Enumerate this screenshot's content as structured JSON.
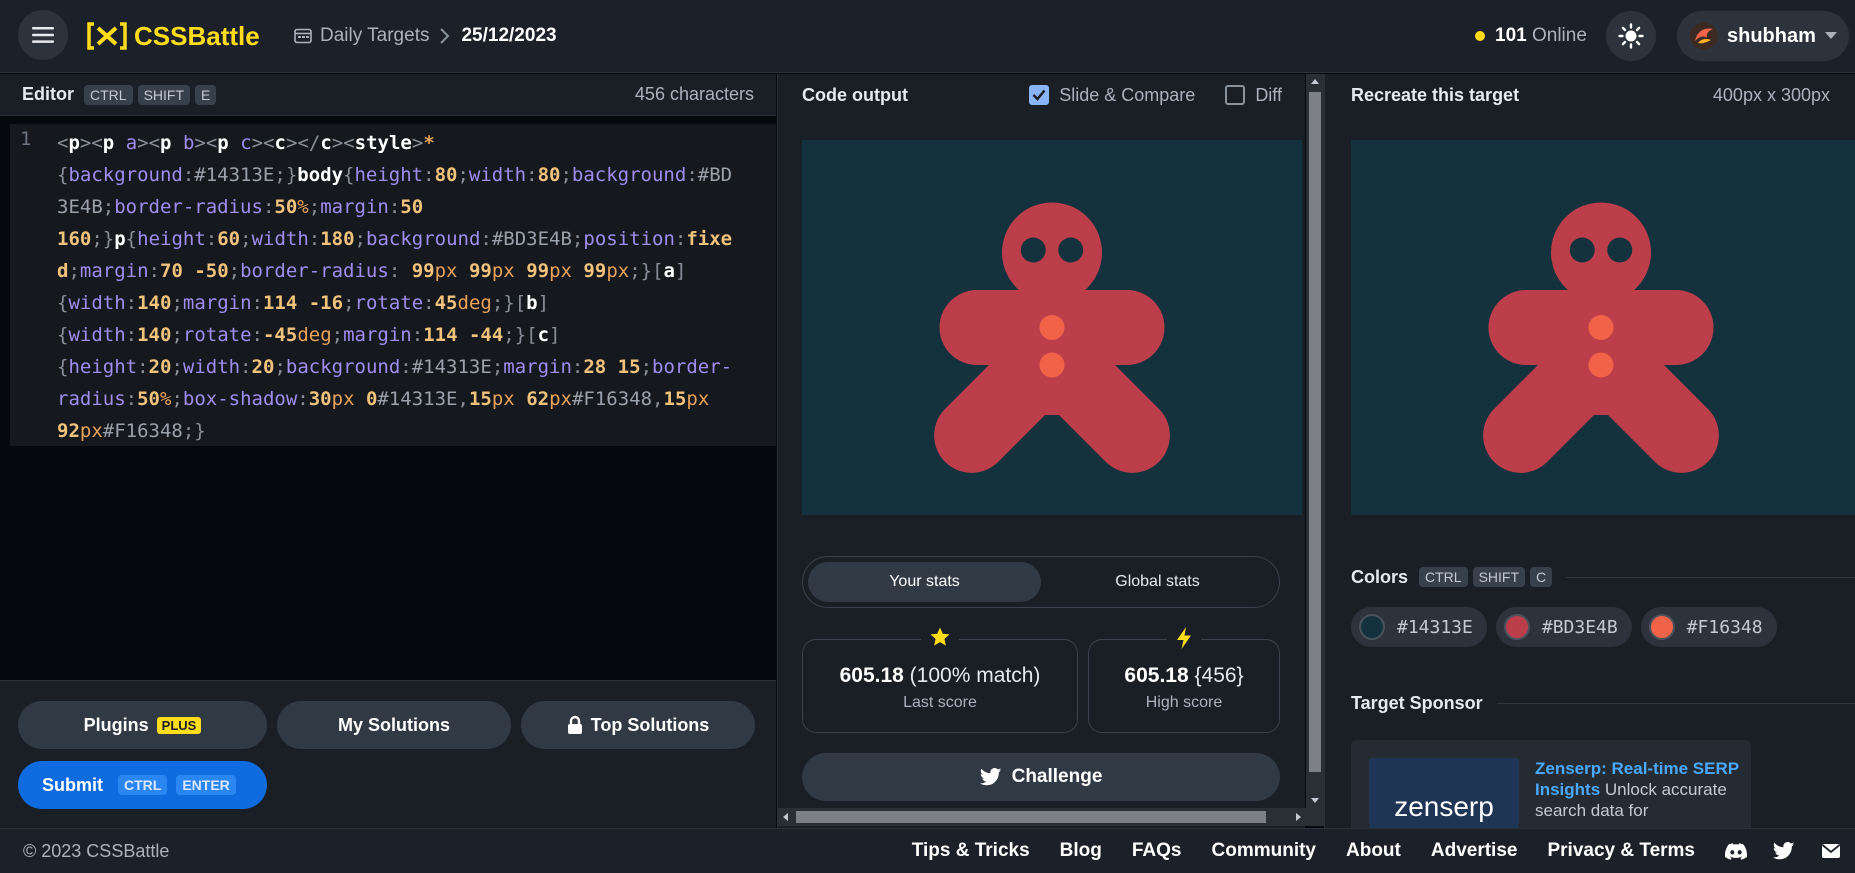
{
  "header": {
    "logo_text": "CSSBattle",
    "breadcrumb_link": "Daily Targets",
    "breadcrumb_current": "25/12/2023",
    "online_count": "101",
    "online_label": "Online",
    "username": "shubham"
  },
  "editor": {
    "title": "Editor",
    "shortcut": [
      "CTRL",
      "SHIFT",
      "E"
    ],
    "char_count": "456 characters",
    "line_number": "1"
  },
  "editor_buttons": {
    "plugins": "Plugins",
    "plus_badge": "PLUS",
    "my_solutions": "My Solutions",
    "top_solutions": "Top Solutions",
    "submit": "Submit",
    "submit_shortcut": [
      "CTRL",
      "ENTER"
    ]
  },
  "output": {
    "title": "Code output",
    "slide_compare": "Slide & Compare",
    "diff": "Diff",
    "stats_tabs": [
      "Your stats",
      "Global stats"
    ],
    "last_score_value": "605.18",
    "last_score_match": "(100% match)",
    "last_score_label": "Last score",
    "high_score_value": "605.18",
    "high_score_chars": "{456}",
    "high_score_label": "High score",
    "challenge": "Challenge"
  },
  "target": {
    "title": "Recreate this target",
    "dimensions": "400px x 300px",
    "colors_title": "Colors",
    "colors_shortcut": [
      "CTRL",
      "SHIFT",
      "C"
    ],
    "colors": [
      "#14313E",
      "#BD3E4B",
      "#F16348"
    ],
    "sponsor_title": "Target Sponsor",
    "sponsor_logo": "zenserp",
    "sponsor_headline": "Zenserp: Real-time SERP Insights",
    "sponsor_body": " Unlock accurate search data for"
  },
  "footer": {
    "copyright": "© 2023 CSSBattle",
    "links": [
      "Tips & Tricks",
      "Blog",
      "FAQs",
      "Community",
      "About",
      "Advertise",
      "Privacy & Terms"
    ]
  },
  "palette": {
    "bg": "#14313E",
    "body": "#BD3E4B",
    "buttons": "#F16348",
    "accent_yellow": "#FFDD1A",
    "submit_blue": "#0F6BE0"
  }
}
